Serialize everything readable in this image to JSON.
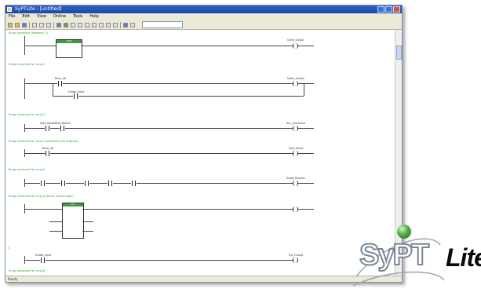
{
  "window": {
    "title": "SyPTLite - [untitled]",
    "menu": [
      "File",
      "Edit",
      "View",
      "Online",
      "Tools",
      "Help"
    ]
  },
  "status": "Ready",
  "rungs": [
    {
      "num": "1",
      "comment": "Rung comment (Network 1)"
    },
    {
      "num": "2",
      "comment": "Rung comment for rung 2"
    },
    {
      "num": "3",
      "comment": "Rung comment for rung 3"
    },
    {
      "num": "4",
      "comment": "Rung comment for rung 4 (contacts and outputs)"
    },
    {
      "num": "5",
      "comment": "Rung comment for rung 5"
    },
    {
      "num": "6",
      "comment": "Rung comment for rung 6 (timer enable logic)"
    },
    {
      "num": "7",
      "comment": ""
    },
    {
      "num": "8",
      "comment": "Rung comment for rung 8"
    }
  ],
  "labels": {
    "fb1": "TON",
    "fb2": "CTU",
    "out1": "Drive_Output",
    "out2": "Motor_Enable",
    "out3": "Run_Command",
    "out4": "Fault_Reset",
    "out5": "Brake_Release",
    "out6": "Trip_Output",
    "in1": "Drive_OK",
    "in2": "Enable_Input",
    "in3": "Start_Button",
    "in4": "Stop_Button"
  },
  "logo": {
    "main": "SyPT",
    "accent": "Lite"
  },
  "colors": {
    "comment_green": "#2c9a2c",
    "block_header": "#3f9a3f",
    "titlebar": "#2f63c9"
  }
}
